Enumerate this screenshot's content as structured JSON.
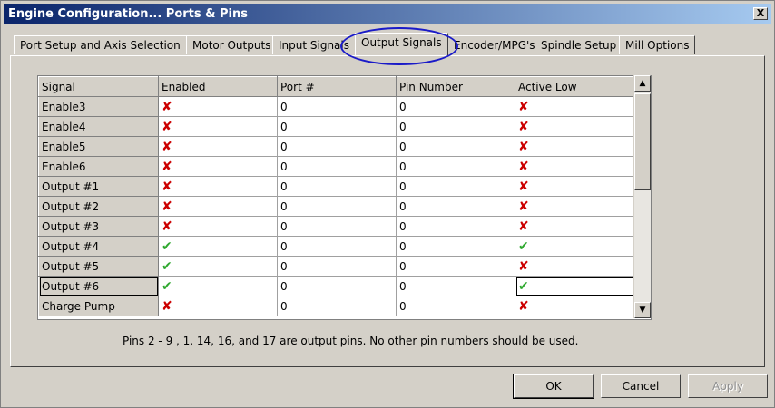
{
  "window": {
    "title": "Engine Configuration... Ports & Pins",
    "close_label": "X"
  },
  "tabs": [
    {
      "label": "Port Setup and Axis Selection"
    },
    {
      "label": "Motor Outputs"
    },
    {
      "label": "Input Signals"
    },
    {
      "label": "Output Signals",
      "active": true
    },
    {
      "label": "Encoder/MPG's"
    },
    {
      "label": "Spindle Setup"
    },
    {
      "label": "Mill Options"
    }
  ],
  "grid": {
    "columns": [
      "Signal",
      "Enabled",
      "Port #",
      "Pin Number",
      "Active Low"
    ],
    "rows": [
      {
        "signal": "Enable3",
        "enabled": "x",
        "port": "0",
        "pin": "0",
        "active_low": "x"
      },
      {
        "signal": "Enable4",
        "enabled": "x",
        "port": "0",
        "pin": "0",
        "active_low": "x"
      },
      {
        "signal": "Enable5",
        "enabled": "x",
        "port": "0",
        "pin": "0",
        "active_low": "x"
      },
      {
        "signal": "Enable6",
        "enabled": "x",
        "port": "0",
        "pin": "0",
        "active_low": "x"
      },
      {
        "signal": "Output #1",
        "enabled": "x",
        "port": "0",
        "pin": "0",
        "active_low": "x"
      },
      {
        "signal": "Output #2",
        "enabled": "x",
        "port": "0",
        "pin": "0",
        "active_low": "x"
      },
      {
        "signal": "Output #3",
        "enabled": "x",
        "port": "0",
        "pin": "0",
        "active_low": "x"
      },
      {
        "signal": "Output #4",
        "enabled": "check",
        "port": "0",
        "pin": "0",
        "active_low": "check"
      },
      {
        "signal": "Output #5",
        "enabled": "check",
        "port": "0",
        "pin": "0",
        "active_low": "x"
      },
      {
        "signal": "Output #6",
        "enabled": "check",
        "port": "0",
        "pin": "0",
        "active_low": "check"
      },
      {
        "signal": "Charge Pump",
        "enabled": "x",
        "port": "0",
        "pin": "0",
        "active_low": "x"
      }
    ]
  },
  "info_text": "Pins 2 - 9 , 1, 14, 16, and 17 are output pins. No  other pin numbers should be used.",
  "buttons": {
    "ok": "OK",
    "cancel": "Cancel",
    "apply": "Apply"
  },
  "icons": {
    "enabled_true": "green-check-icon",
    "enabled_false": "red-x-icon"
  },
  "colors": {
    "title_start": "#0a246a",
    "title_end": "#a6caf0",
    "x_mark": "#cc0000",
    "check_mark": "#2fa82f",
    "highlight": "#1a1ac8"
  }
}
